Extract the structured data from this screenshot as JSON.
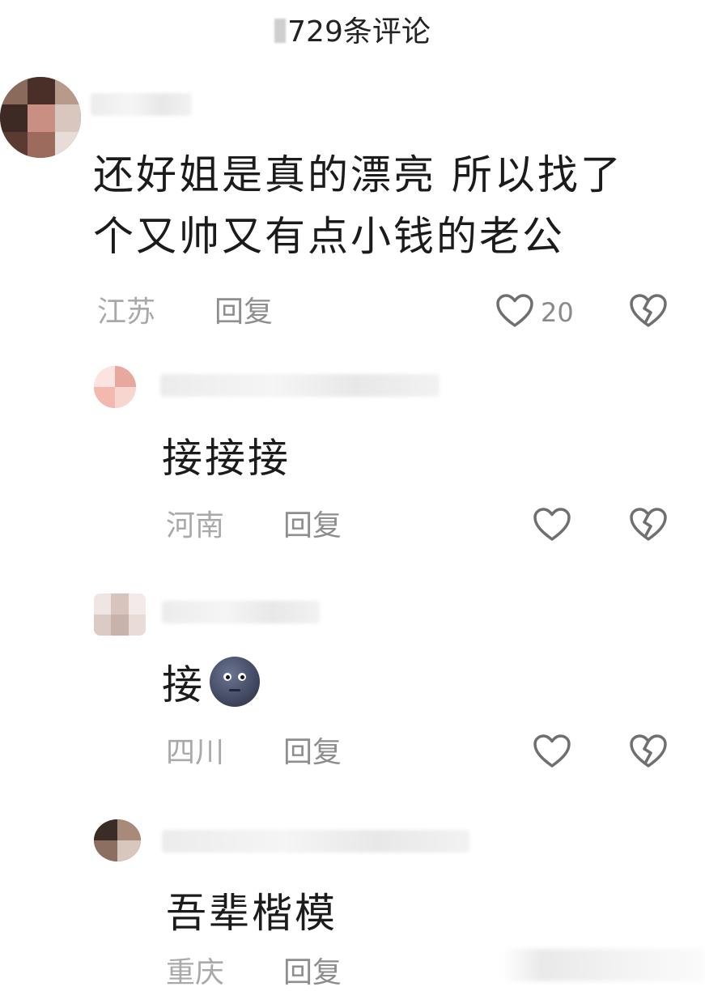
{
  "header": {
    "comment_count_label": "729条评论"
  },
  "comments": [
    {
      "text_line1": "还好姐是真的漂亮 所以找了",
      "text_line2": "个又帅又有点小钱的老公",
      "location": "江苏",
      "reply_label": "回复",
      "like_count": "20"
    },
    {
      "text": "接接接",
      "location": "河南",
      "reply_label": "回复",
      "like_count": ""
    },
    {
      "text": "接",
      "emoji": "new-moon-face",
      "location": "四川",
      "reply_label": "回复",
      "like_count": ""
    },
    {
      "text": "吾辈楷模",
      "location": "重庆",
      "reply_label": "回复",
      "like_count": ""
    }
  ],
  "icons": {
    "like": "heart-outline-icon",
    "dislike": "broken-heart-icon"
  },
  "colors": {
    "text": "#1b1b1b",
    "meta": "#a9a9a9",
    "icon": "#6f6f6f"
  }
}
